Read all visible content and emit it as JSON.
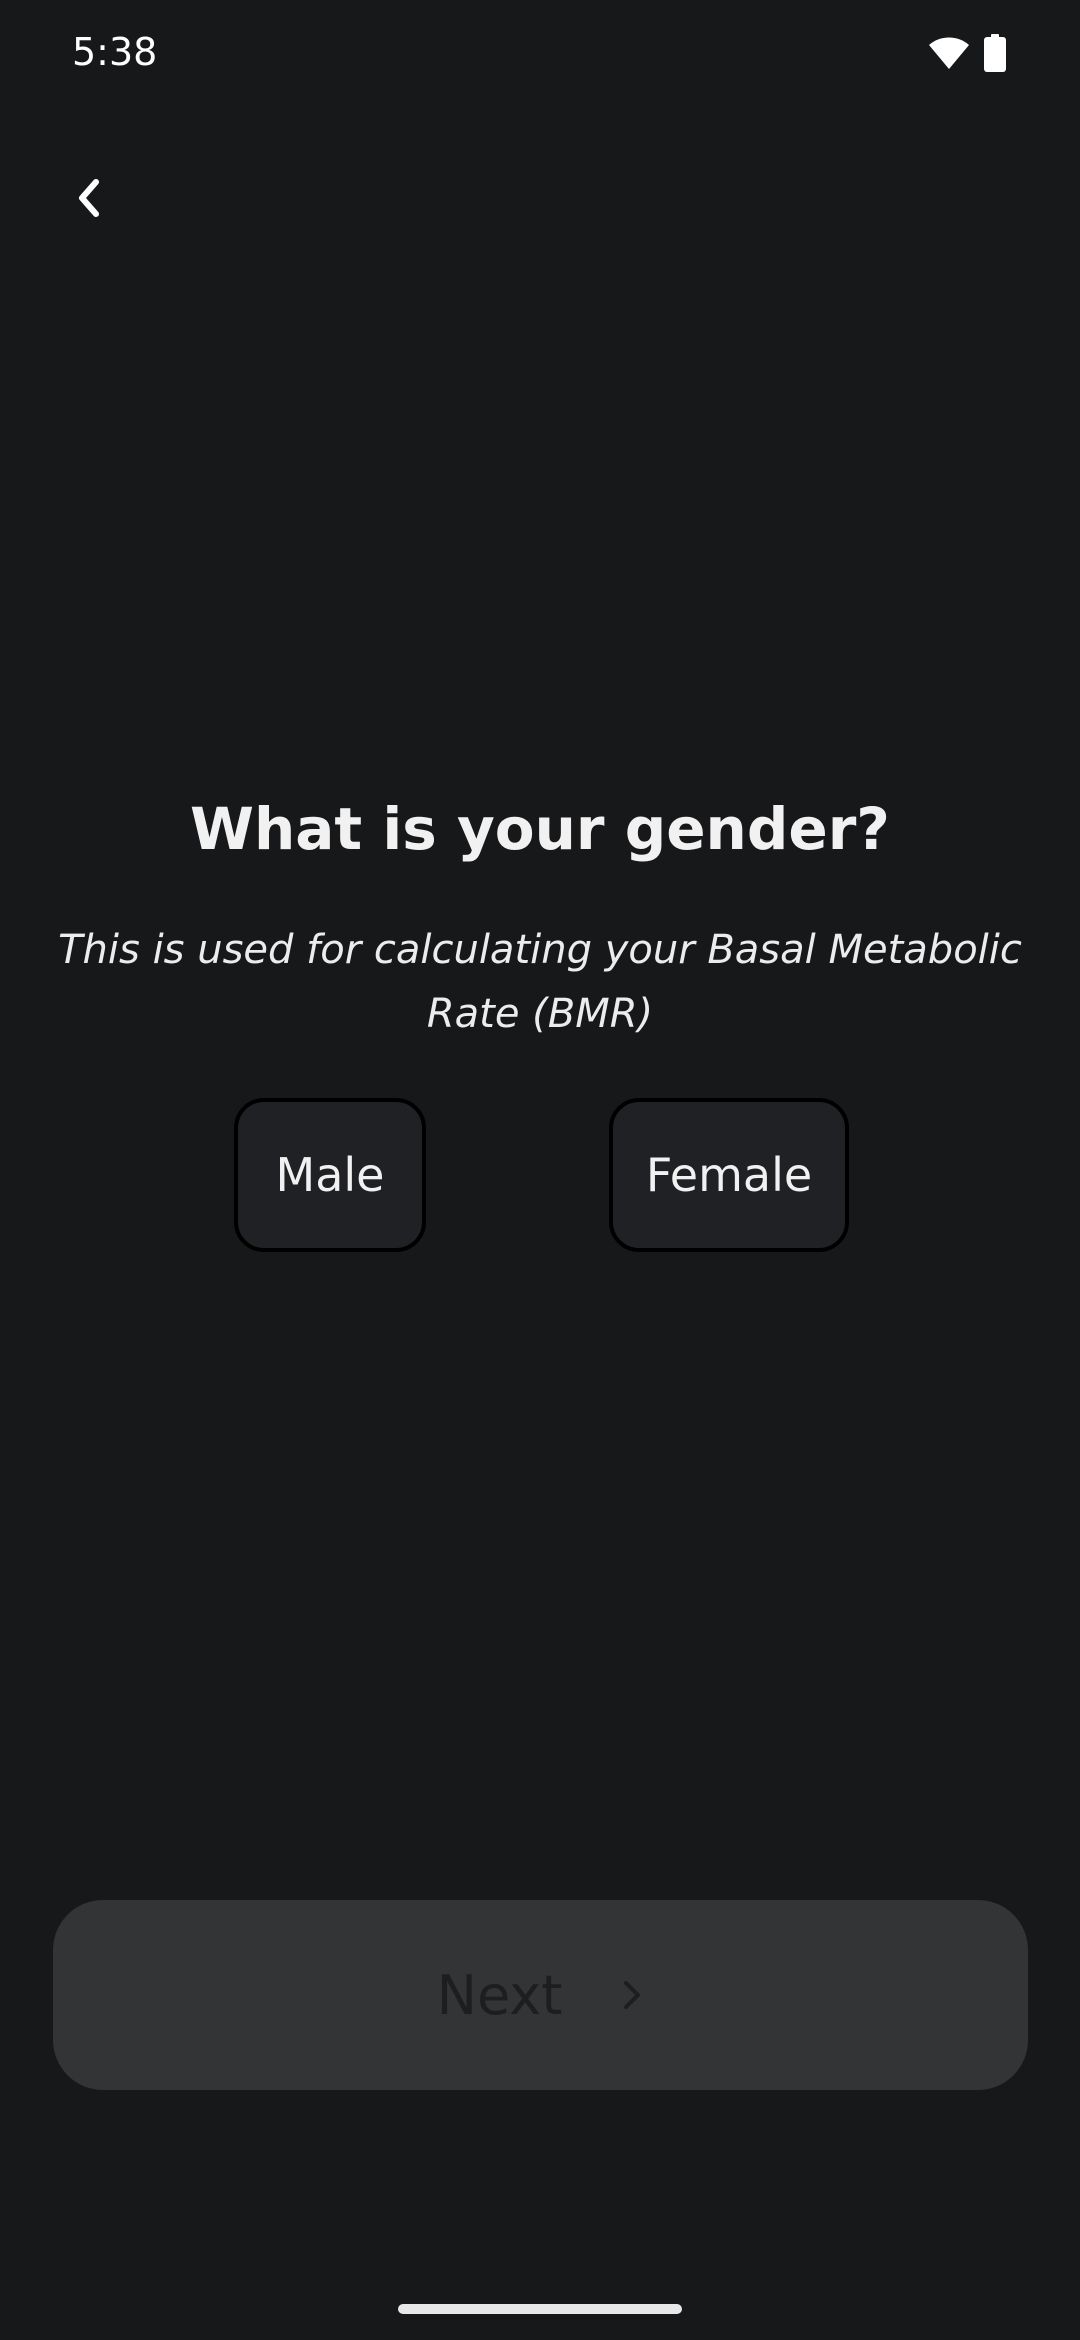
{
  "status_bar": {
    "time": "5:38",
    "wifi_icon": "wifi-icon",
    "battery_icon": "battery-icon"
  },
  "navigation": {
    "back_icon": "chevron-left-icon"
  },
  "question": {
    "title": "What is your gender?",
    "subtitle": "This is used for calculating your Basal Metabolic Rate (BMR)"
  },
  "options": [
    {
      "label": "Male"
    },
    {
      "label": "Female"
    }
  ],
  "next_button": {
    "label": "Next",
    "icon": "chevron-right-icon"
  },
  "colors": {
    "background": "#17181a",
    "option_background": "#202124",
    "option_border": "#000000",
    "next_background": "#333436",
    "next_label": "#1d1e20",
    "text": "#f1f1f2"
  }
}
